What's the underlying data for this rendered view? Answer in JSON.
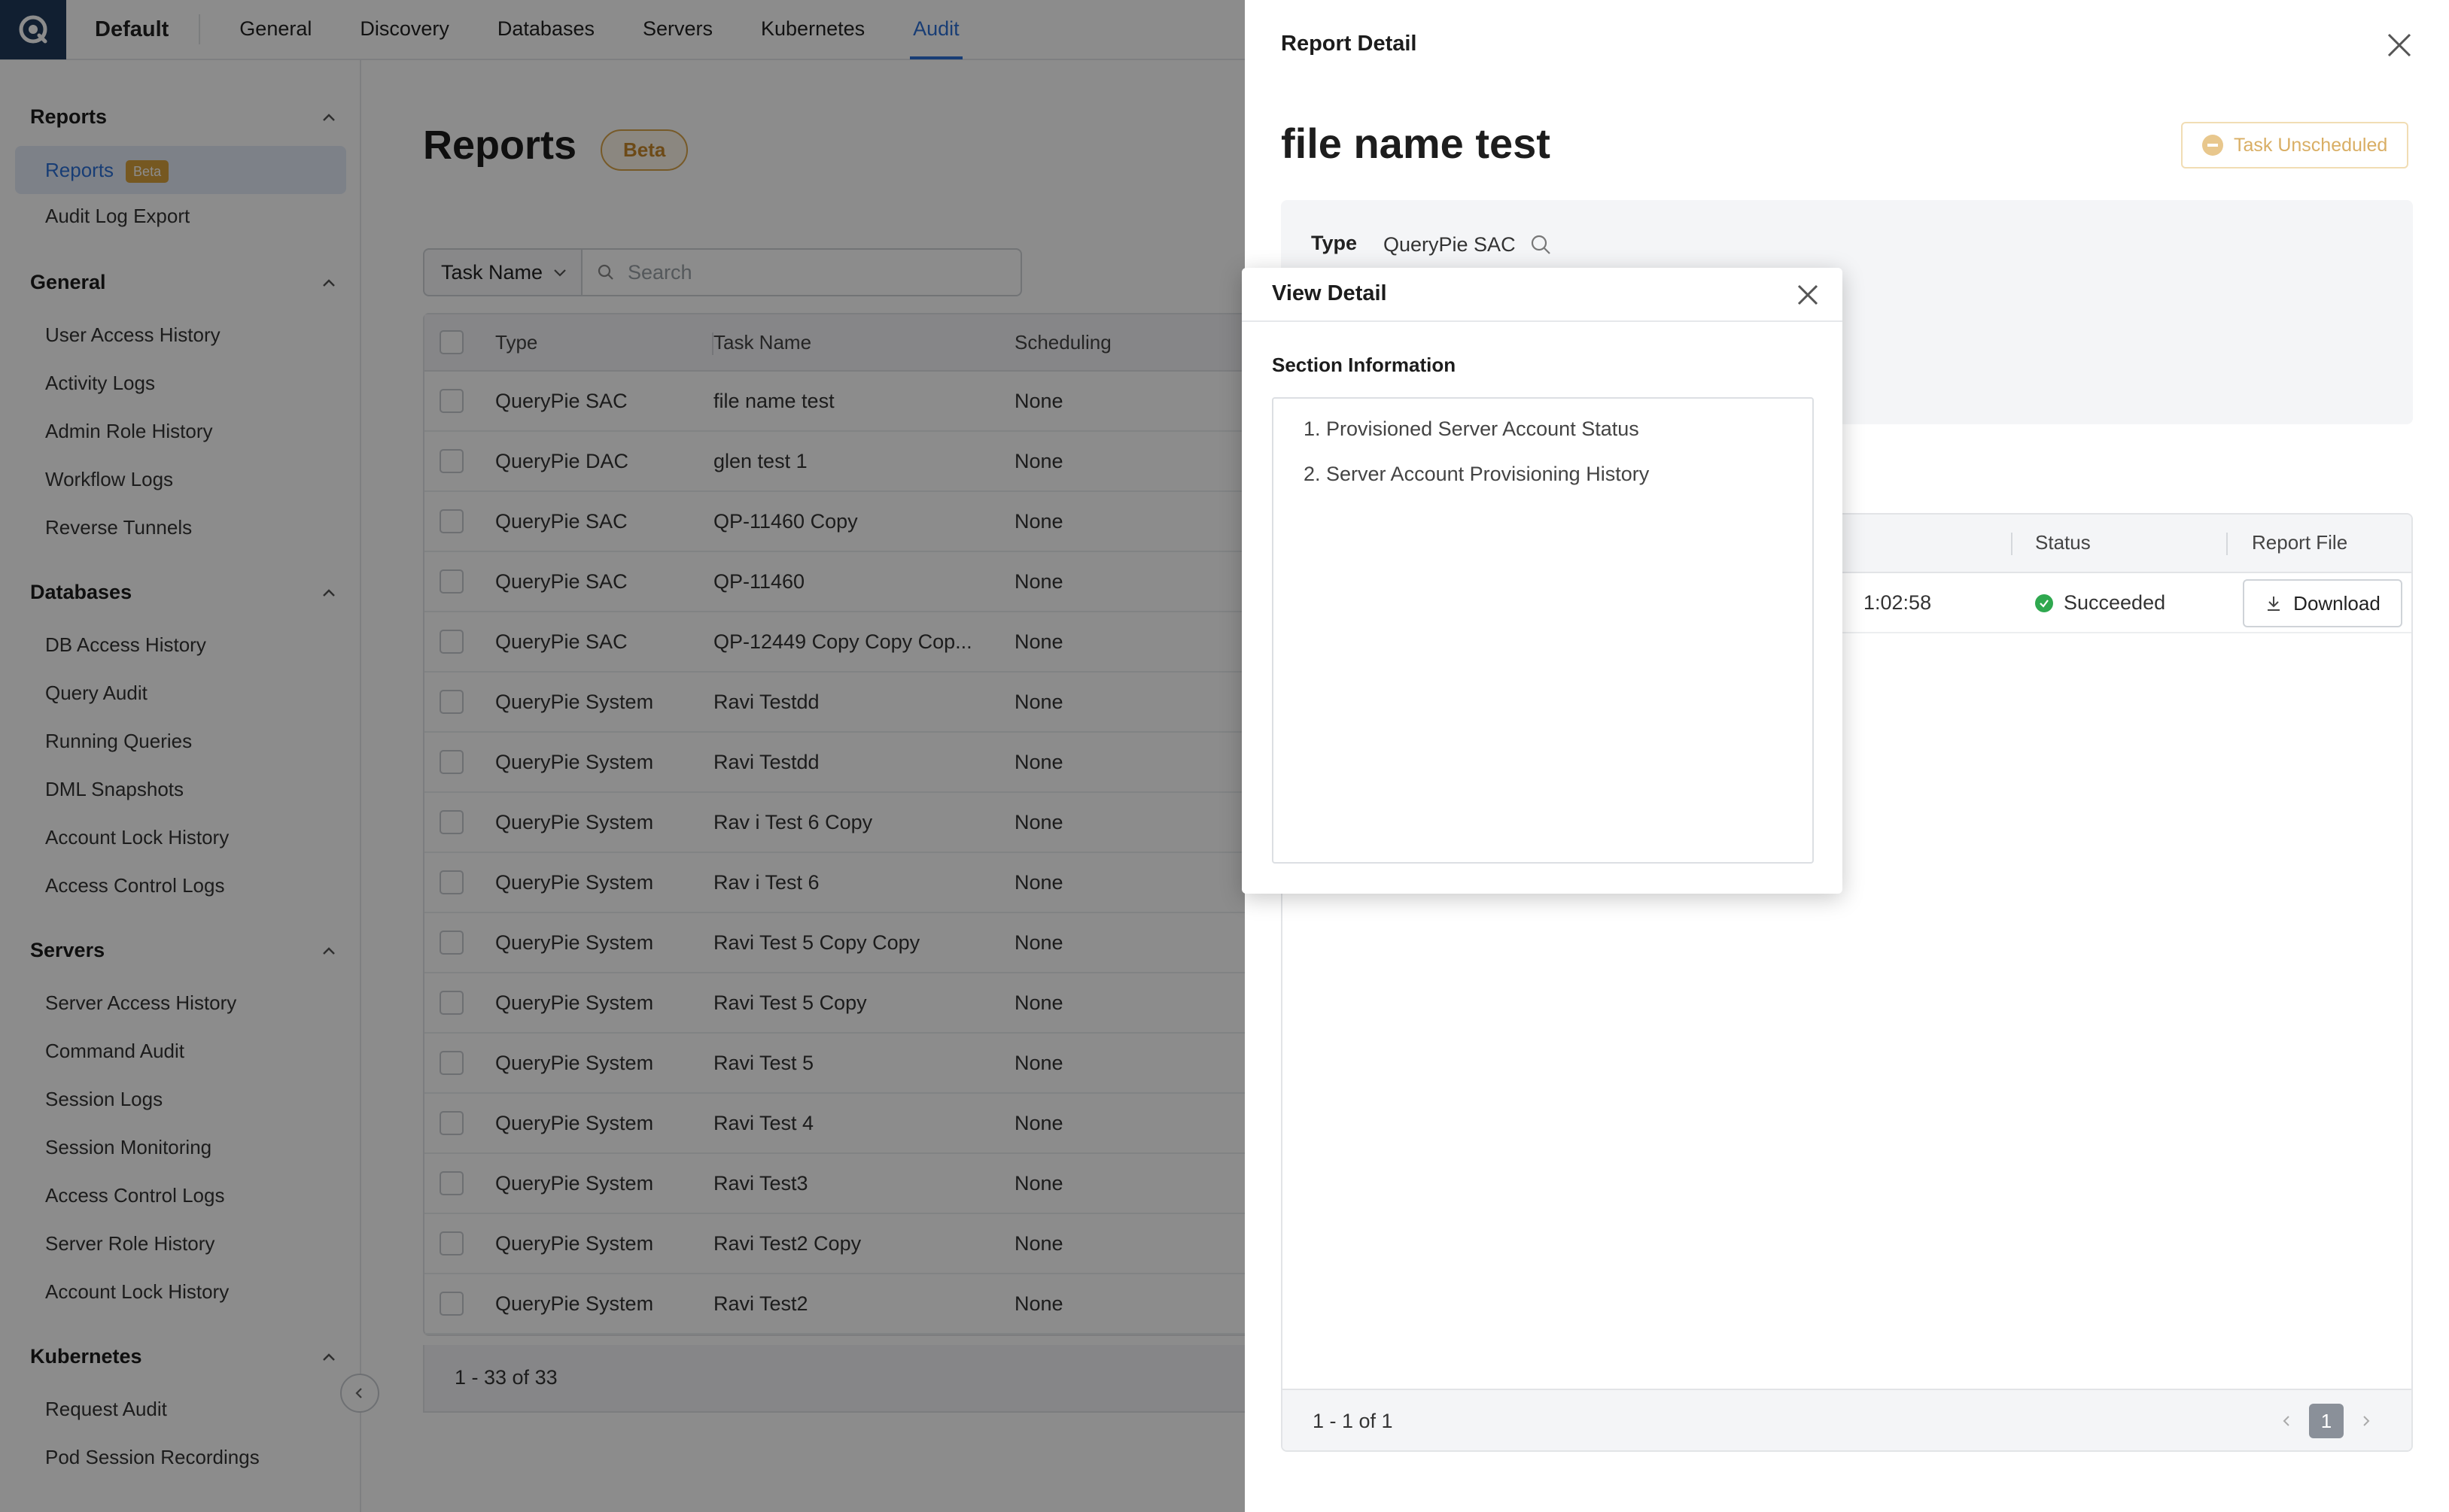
{
  "topnav": {
    "workspace": "Default",
    "tabs": [
      "General",
      "Discovery",
      "Databases",
      "Servers",
      "Kubernetes",
      "Audit"
    ],
    "active_tab": "Audit"
  },
  "sidebar": {
    "reports": {
      "title": "Reports",
      "items": [
        "Reports",
        "Audit Log Export"
      ],
      "badge": "Beta"
    },
    "general": {
      "title": "General",
      "items": [
        "User Access History",
        "Activity Logs",
        "Admin Role History",
        "Workflow Logs",
        "Reverse Tunnels"
      ]
    },
    "databases": {
      "title": "Databases",
      "items": [
        "DB Access History",
        "Query Audit",
        "Running Queries",
        "DML Snapshots",
        "Account Lock History",
        "Access Control Logs"
      ]
    },
    "servers": {
      "title": "Servers",
      "items": [
        "Server Access History",
        "Command Audit",
        "Session Logs",
        "Session Monitoring",
        "Access Control Logs",
        "Server Role History",
        "Account Lock History"
      ]
    },
    "kubernetes": {
      "title": "Kubernetes",
      "items": [
        "Request Audit",
        "Pod Session Recordings"
      ]
    }
  },
  "main": {
    "title": "Reports",
    "beta": "Beta",
    "filter_label": "Task Name",
    "search_placeholder": "Search",
    "columns": [
      "Type",
      "Task Name",
      "Scheduling"
    ],
    "rows": [
      [
        "QueryPie SAC",
        "file name test",
        "None"
      ],
      [
        "QueryPie DAC",
        "glen test 1",
        "None"
      ],
      [
        "QueryPie SAC",
        "QP-11460 Copy",
        "None"
      ],
      [
        "QueryPie SAC",
        "QP-11460",
        "None"
      ],
      [
        "QueryPie SAC",
        "QP-12449 Copy Copy Cop...",
        "None"
      ],
      [
        "QueryPie System",
        "Ravi Testdd",
        "None"
      ],
      [
        "QueryPie System",
        "Ravi Testdd",
        "None"
      ],
      [
        "QueryPie System",
        "Rav i Test 6 Copy",
        "None"
      ],
      [
        "QueryPie System",
        "Rav i Test 6",
        "None"
      ],
      [
        "QueryPie System",
        "Ravi Test 5 Copy Copy",
        "None"
      ],
      [
        "QueryPie System",
        "Ravi Test 5 Copy",
        "None"
      ],
      [
        "QueryPie System",
        "Ravi Test 5",
        "None"
      ],
      [
        "QueryPie System",
        "Ravi Test 4",
        "None"
      ],
      [
        "QueryPie System",
        "Ravi Test3",
        "None"
      ],
      [
        "QueryPie System",
        "Ravi Test2 Copy",
        "None"
      ],
      [
        "QueryPie System",
        "Ravi Test2",
        "None"
      ]
    ],
    "pagination": "1 - 33 of 33"
  },
  "drawer": {
    "title": "Report Detail",
    "heading": "file name test",
    "status_button": "Task Unscheduled",
    "type_label": "Type",
    "type_value": "QueryPie SAC",
    "history": {
      "columns": [
        "Status",
        "Report File"
      ],
      "row": {
        "time_fragment": "1:02:58",
        "status": "Succeeded",
        "action": "Download"
      },
      "pagination": "1 - 1 of 1",
      "page": "1"
    }
  },
  "modal": {
    "title": "View Detail",
    "section_title": "Section Information",
    "items": [
      "1. Provisioned Server Account Status",
      "2. Server Account Provisioning History"
    ]
  }
}
